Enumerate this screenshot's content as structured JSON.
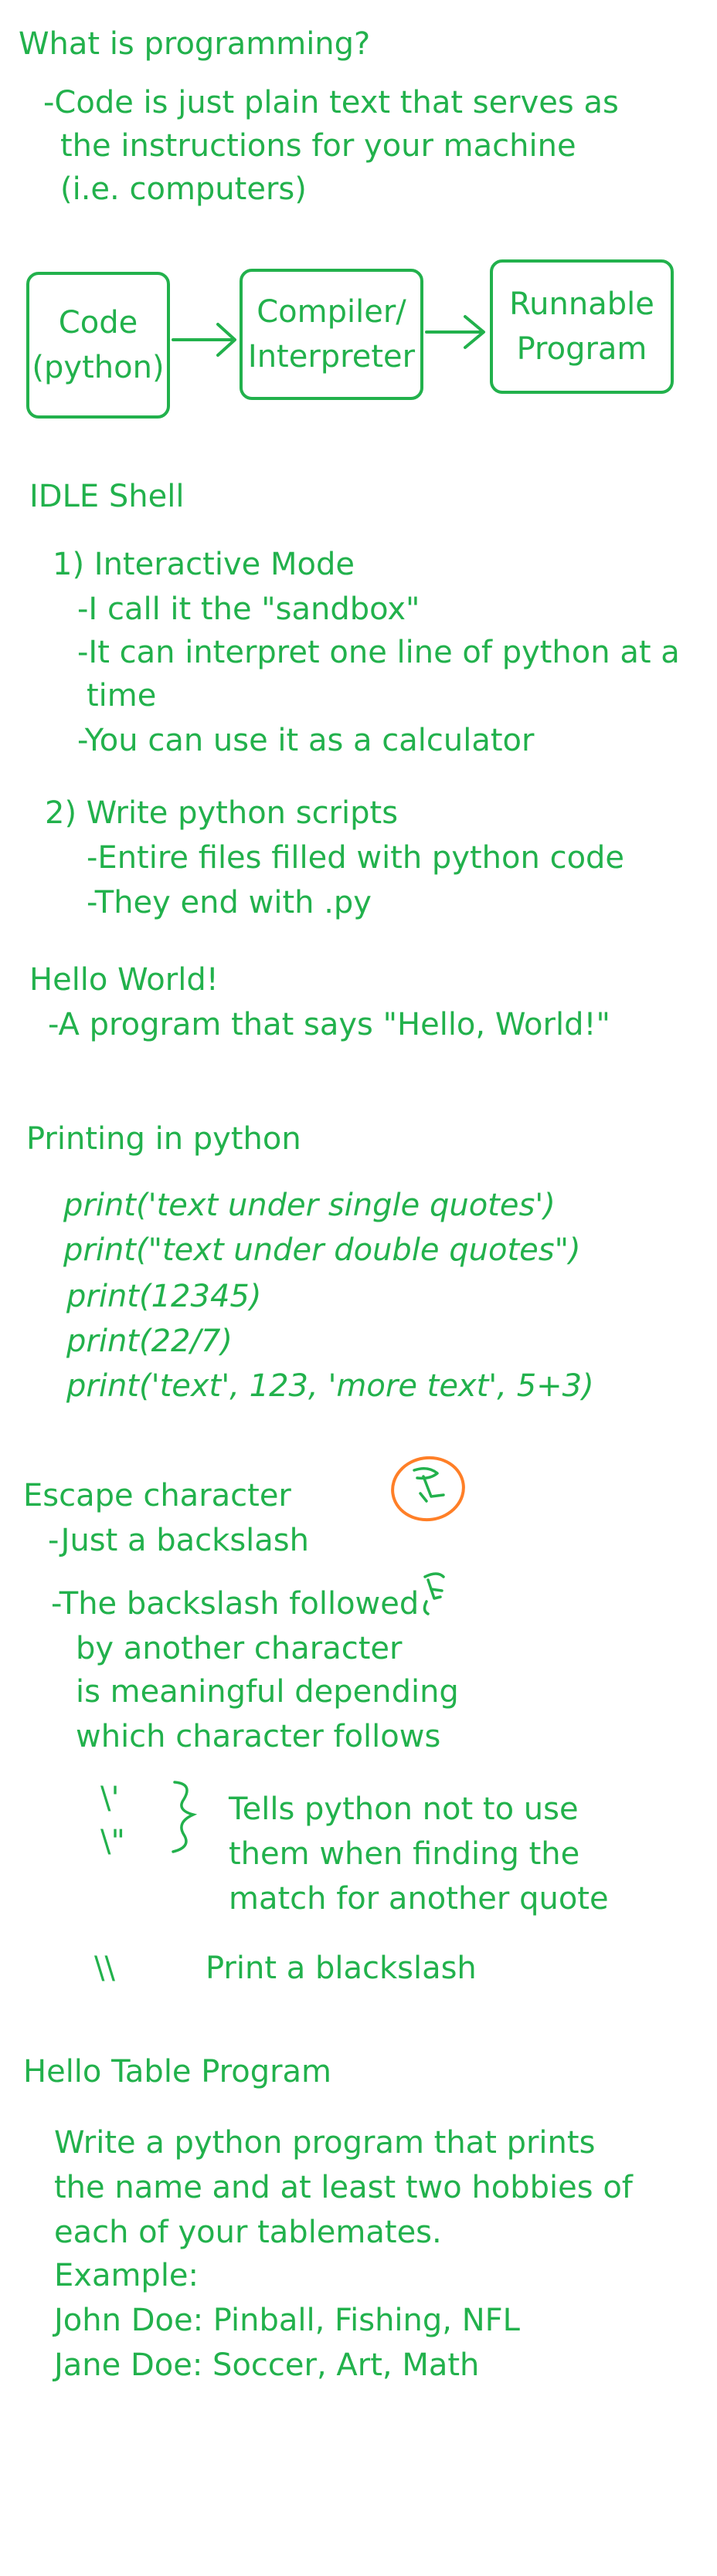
{
  "s1": {
    "heading": "What is programming?",
    "lines": [
      "-Code is just plain text that serves as",
      "the instructions for your machine",
      "(i.e. computers)"
    ]
  },
  "diagram": {
    "box1": [
      "Code",
      "(python)"
    ],
    "box2": [
      "Compiler/",
      "Interpreter"
    ],
    "box3": [
      "Runnable",
      "Program"
    ]
  },
  "s2": {
    "heading": "IDLE Shell",
    "mode1": "1) Interactive Mode",
    "mode1_lines": [
      "-I call it the \"sandbox\"",
      "-It can interpret one line of python at a",
      "time",
      "-You can use it as a calculator"
    ],
    "mode2": "2) Write python scripts",
    "mode2_lines": [
      "-Entire files filled with python code",
      "-They end with .py"
    ]
  },
  "s3": {
    "heading": "Hello World!",
    "line": "-A program that says \"Hello, World!\""
  },
  "s4": {
    "heading": "Printing in python",
    "code": [
      "print('text under single quotes')",
      "print(\"text under double quotes\")",
      "print(12345)",
      "print(22/7)",
      "print('text', 123, 'more text', 5+3)"
    ]
  },
  "s5": {
    "heading": "Escape character",
    "line1": "-Just a backslash",
    "line2": "-The backslash followed",
    "line2_cont": [
      "by another character",
      "is meaningful depending",
      "which character follows"
    ],
    "esc1": "\\'",
    "esc2": "\\\"",
    "esc_note": [
      "Tells python not to use",
      "them when finding the",
      "match for another quote"
    ],
    "esc3": "\\\\",
    "esc3_note": "Print a blackslash"
  },
  "s6": {
    "heading": "Hello Table Program",
    "lines": [
      "Write a python program that prints",
      "the name and at least two hobbies of",
      "each of your tablemates.",
      "Example:",
      "John Doe: Pinball, Fishing, NFL",
      "Jane Doe: Soccer, Art, Math"
    ]
  },
  "colors": {
    "ink": "#22b14c",
    "highlight": "#ff7f27"
  },
  "icons": {
    "doodle1": "handwritten-backslash-symbol-circled",
    "doodle2": "handwritten-backslash-symbol"
  }
}
